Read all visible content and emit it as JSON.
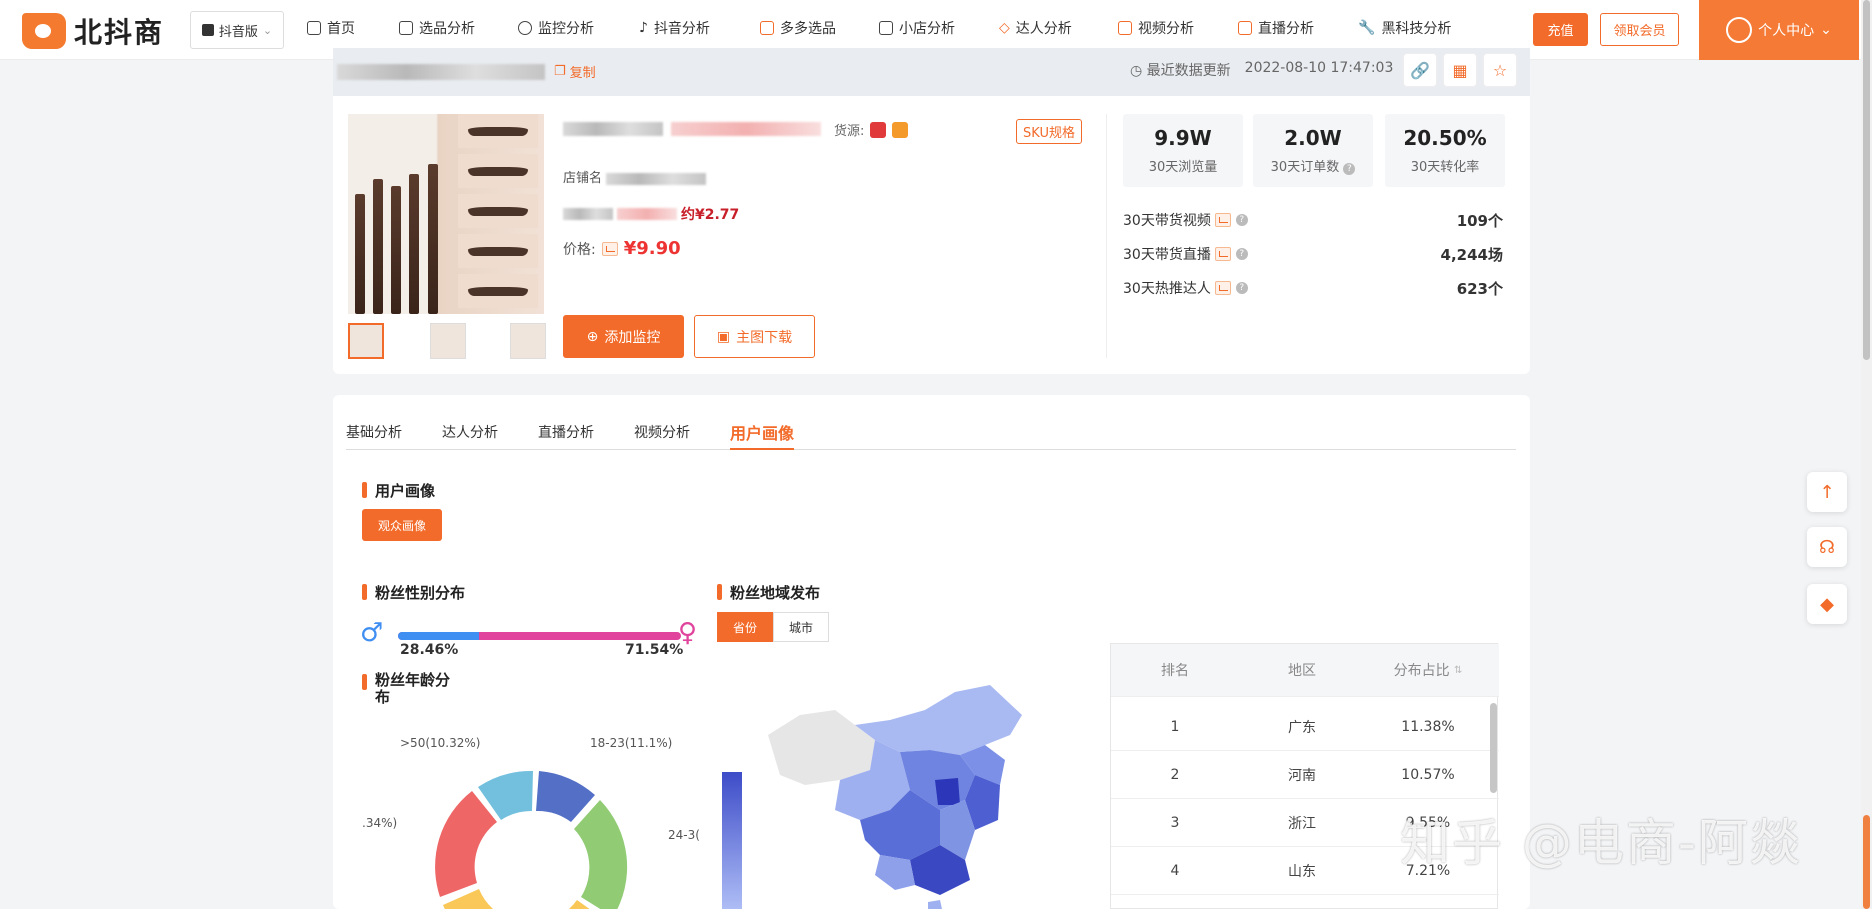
{
  "app": {
    "logo_text": "北抖商",
    "version": "抖音版"
  },
  "nav": [
    "首页",
    "选品分析",
    "监控分析",
    "抖音分析",
    "多多选品",
    "小店分析",
    "达人分析",
    "视频分析",
    "直播分析",
    "黑科技分析"
  ],
  "header_actions": {
    "charge": "充值",
    "member": "领取会员",
    "user_center": "个人中心"
  },
  "product": {
    "copy_label": "复制",
    "update_label": "最近数据更新",
    "update_time": "2022-08-10 17:47:03",
    "source_label": "货源:",
    "sku_label": "SKU规格",
    "shop_label": "店铺名",
    "coupon_price": "约¥2.77",
    "price_label": "价格:",
    "price": "¥9.90",
    "btn_monitor": "添加监控",
    "btn_download": "主图下载"
  },
  "stats": [
    {
      "value": "9.9W",
      "label": "30天浏览量"
    },
    {
      "value": "2.0W",
      "label": "30天订单数"
    },
    {
      "value": "20.50%",
      "label": "30天转化率"
    }
  ],
  "metrics": [
    {
      "label": "30天带货视频",
      "value": "109个"
    },
    {
      "label": "30天带货直播",
      "value": "4,244场"
    },
    {
      "label": "30天热推达人",
      "value": "623个"
    }
  ],
  "tabs": [
    "基础分析",
    "达人分析",
    "直播分析",
    "视频分析",
    "用户画像"
  ],
  "portrait": {
    "title": "用户画像",
    "audience_btn": "观众画像",
    "gender_title": "粉丝性别分布",
    "male_pct": "28.46%",
    "female_pct": "71.54%",
    "male_fraction": 0.2846,
    "age_title": "粉丝年龄分布",
    "region_title": "粉丝地域发布",
    "seg_province": "省份",
    "seg_city": "城市"
  },
  "age_labels": {
    "a": "18-23(11.1%)",
    "b": ">50(10.32%)",
    "c": "24-3(",
    "d": ".34%)"
  },
  "region_table": {
    "headers": [
      "排名",
      "地区",
      "分布占比"
    ],
    "rows": [
      [
        "1",
        "广东",
        "11.38%"
      ],
      [
        "2",
        "河南",
        "10.57%"
      ],
      [
        "3",
        "浙江",
        "9.55%"
      ],
      [
        "4",
        "山东",
        "7.21%"
      ]
    ]
  },
  "watermark": "知乎 @电商-阿燚",
  "colors": {
    "accent": "#f26b2a",
    "male": "#3f8ef2",
    "female": "#e0449c"
  }
}
